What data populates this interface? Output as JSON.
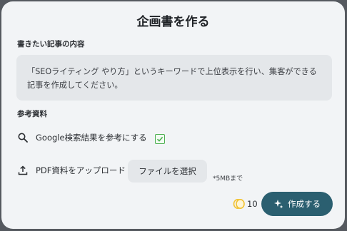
{
  "dialog": {
    "title": "企画書を作る",
    "article_content_label": "書きたい記事の内容",
    "article_content_value": "「SEOライティング やり方」というキーワードで上位表示を行い、集客ができる記事を作成してください。",
    "reference_label": "参考資料",
    "google_option_label": "Google検索結果を参考にする",
    "google_option_checked": true,
    "pdf_upload_label": "PDF資料をアップロード",
    "file_select_button": "ファイルを選択",
    "file_size_note": "*5MBまで",
    "credits_count": "10",
    "create_button": "作成する"
  },
  "colors": {
    "primary": "#2b5f70",
    "check_green": "#4caf50",
    "coin_yellow": "#f2c230"
  },
  "icons": [
    "search-icon",
    "upload-icon",
    "checkbox-checked-icon",
    "coin-icon",
    "sparkle-icon"
  ]
}
